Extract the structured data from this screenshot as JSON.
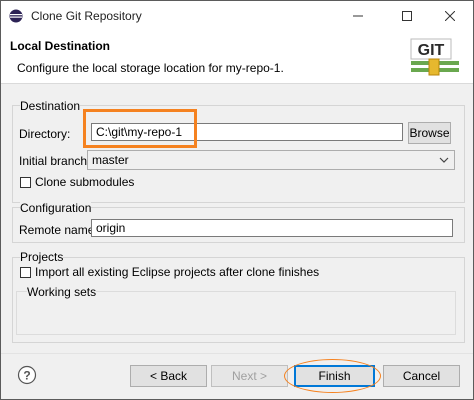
{
  "window": {
    "title": "Clone Git Repository",
    "icons": [
      "eclipse-icon",
      "minimize-icon",
      "maximize-icon",
      "close-icon"
    ]
  },
  "header": {
    "title": "Local Destination",
    "description": "Configure the local storage location for my-repo-1.",
    "logo_text": "GIT"
  },
  "destination": {
    "group_label": "Destination",
    "directory_label": "Directory:",
    "directory_value": "C:\\git\\my-repo-1",
    "browse_label": "Browse",
    "branch_label": "Initial branch:",
    "branch_value": "master",
    "clone_submodules_label": "Clone submodules",
    "clone_submodules_checked": false
  },
  "configuration": {
    "group_label": "Configuration",
    "remote_label": "Remote name:",
    "remote_value": "origin"
  },
  "projects": {
    "group_label": "Projects",
    "import_label": "Import all existing Eclipse projects after clone finishes",
    "import_checked": false,
    "working_sets_label": "Working sets"
  },
  "footer": {
    "back_label": "< Back",
    "next_label": "Next >",
    "finish_label": "Finish",
    "cancel_label": "Cancel"
  },
  "colors": {
    "highlight": "#f58220",
    "default_button_border": "#0078d7"
  }
}
